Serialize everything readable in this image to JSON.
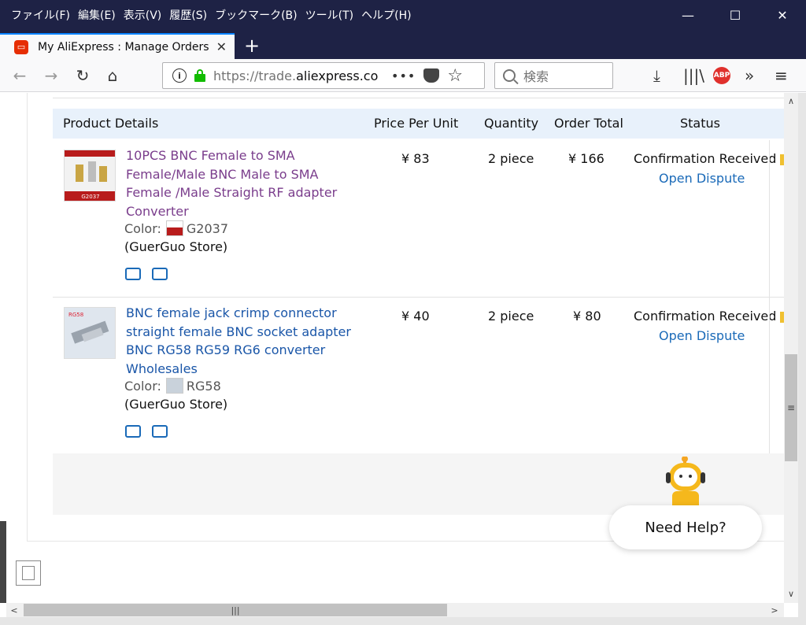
{
  "menu": [
    "ファイル(F)",
    "編集(E)",
    "表示(V)",
    "履歴(S)",
    "ブックマーク(B)",
    "ツール(T)",
    "ヘルプ(H)"
  ],
  "window_controls": {
    "minimize": "—",
    "maximize": "☐",
    "close": "✕"
  },
  "tab": {
    "title": "My AliExpress : Manage Orders",
    "close": "✕",
    "favicon": "aliexpress-icon"
  },
  "newtab": "+",
  "nav": {
    "url_prefix": "https://trade.",
    "url_domain": "aliexpress.co",
    "search_placeholder": "検索",
    "more": "•••"
  },
  "table": {
    "headers": {
      "product": "Product Details",
      "price": "Price Per Unit",
      "quantity": "Quantity",
      "total": "Order Total",
      "status": "Status"
    },
    "orders": [
      {
        "title": "10PCS BNC Female to SMA Female/Male BNC Male to SMA Female /Male Straight RF adapter Converter",
        "color_label": "Color:",
        "color_value": "G2037",
        "store": "(GuerGuo Store)",
        "price": "¥ 83",
        "quantity": "2 piece",
        "total": "¥ 166",
        "status": "Confirmation Received",
        "action": "Open Dispute",
        "thumb_caption": "G2037"
      },
      {
        "title": "BNC female jack crimp connector straight female BNC socket adapter BNC RG58 RG59 RG6 converter Wholesales",
        "color_label": "Color:",
        "color_value": "RG58",
        "store": "(GuerGuo Store)",
        "price": "¥ 40",
        "quantity": "2 piece",
        "total": "¥ 80",
        "status": "Confirmation Received",
        "action": "Open Dispute",
        "thumb_caption": "RG58"
      }
    ]
  },
  "help": {
    "label": "Need Help?"
  },
  "colors": {
    "accent_link": "#1a6ab8",
    "visited_link": "#7a3d8c",
    "header_bg": "#e8f1fb",
    "titlebar": "#1e2245"
  }
}
